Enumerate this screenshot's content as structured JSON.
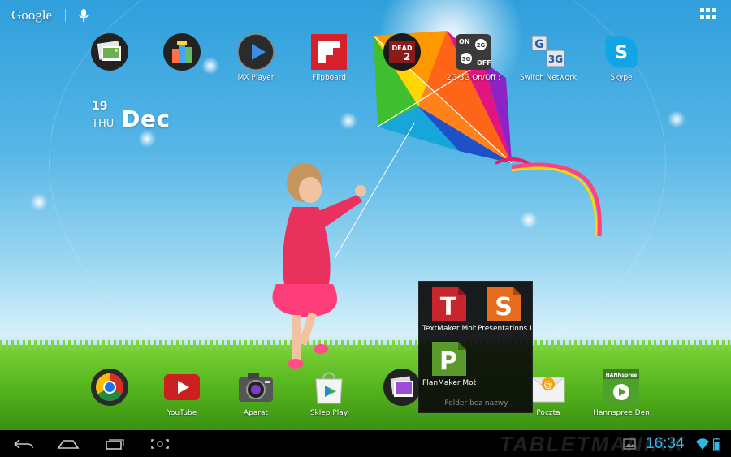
{
  "search": {
    "logo_text": "Google"
  },
  "date_widget": {
    "day": "19",
    "weekday": "THU",
    "month": "Dec"
  },
  "top_apps": [
    {
      "label": "",
      "icon": "gallery-widget-icon"
    },
    {
      "label": "",
      "icon": "office-suite-icon"
    },
    {
      "label": "MX Player",
      "icon": "play-icon"
    },
    {
      "label": "Flipboard",
      "icon": "flipboard-icon"
    },
    {
      "label": "",
      "icon": "dead-trigger-icon"
    },
    {
      "label": "2G-3G On/Off :",
      "icon": "network-toggle-icon"
    },
    {
      "label": "Switch Network",
      "icon": "switch-network-icon"
    },
    {
      "label": "Skype",
      "icon": "skype-icon"
    }
  ],
  "dock_apps": [
    {
      "label": "",
      "icon": "chrome-icon"
    },
    {
      "label": "YouTube",
      "icon": "youtube-icon"
    },
    {
      "label": "Aparat",
      "icon": "camera-icon"
    },
    {
      "label": "Sklep Play",
      "icon": "play-store-icon"
    },
    {
      "label": "",
      "icon": "gallery-icon"
    },
    {
      "label": "Poczta",
      "icon": "email-icon"
    },
    {
      "label": "Hannspree Den",
      "icon": "hannspree-icon"
    }
  ],
  "folder": {
    "name": "Folder bez nazwy",
    "apps": [
      {
        "label": "TextMaker Mob",
        "letter": "T",
        "color": "#c8262c"
      },
      {
        "label": "Presentations M",
        "letter": "S",
        "color": "#e66d1e"
      },
      {
        "label": "PlanMaker Mob",
        "letter": "P",
        "color": "#5a9a2a"
      }
    ]
  },
  "status_bar": {
    "time": "16:34"
  },
  "watermark": "TABLETMANIAK",
  "colors": {
    "clock": "#33b5e5",
    "grass": "#58b81f",
    "sky": "#56b6e6"
  }
}
